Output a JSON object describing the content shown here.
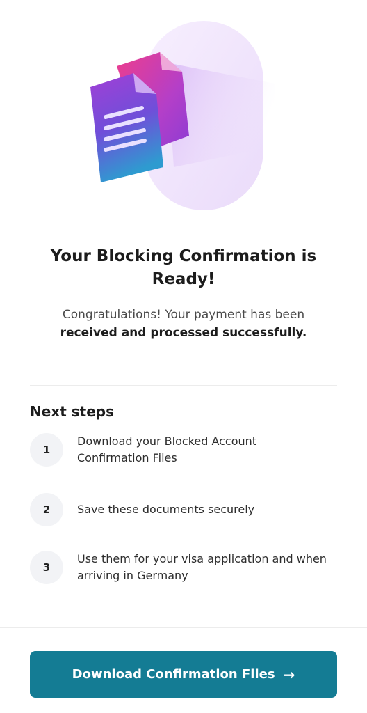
{
  "header": {
    "title": "Your Blocking Confirmation is Ready!",
    "subtitle_line1": "Congratulations! Your payment has been",
    "subtitle_line2": "received and processed successfully."
  },
  "illustration": {
    "icon": "documents-icon",
    "colors": {
      "pink": "#e0338f",
      "purple": "#8b3fd6",
      "blue": "#2f8ecf",
      "glow": "#efe2fb"
    }
  },
  "next_steps": {
    "heading": "Next steps",
    "items": [
      {
        "num": "1",
        "text": "Download your Blocked Account Confirmation Files"
      },
      {
        "num": "2",
        "text": "Save these documents securely"
      },
      {
        "num": "3",
        "text": "Use them for your visa application and when arriving in Germany"
      }
    ]
  },
  "footer": {
    "button_label": "Download Confirmation Files",
    "button_icon": "arrow-right-icon",
    "button_color": "#147c94"
  }
}
